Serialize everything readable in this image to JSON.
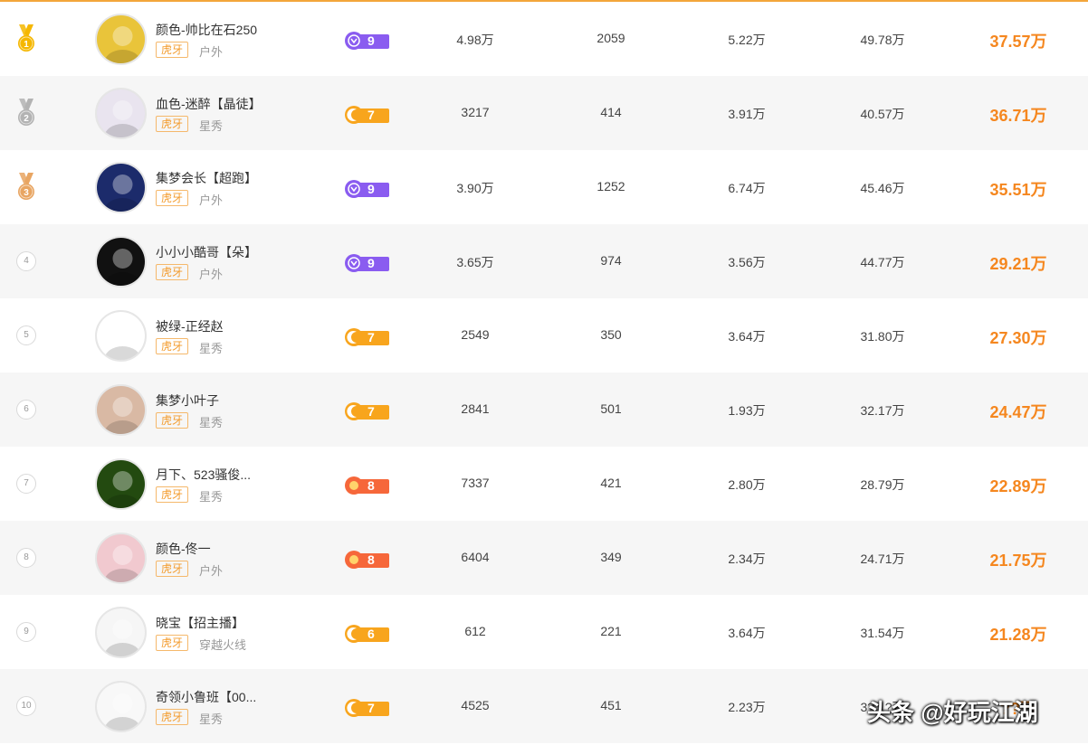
{
  "rows": [
    {
      "rank": "1",
      "name": "颜色-帅比在石250",
      "platform": "虎牙",
      "category": "户外",
      "level": "9",
      "levelColor": "#8a5cf0",
      "levelIcon": "purple",
      "v1": "4.98万",
      "v2": "2059",
      "v3": "5.22万",
      "v4": "49.78万",
      "total": "37.57万"
    },
    {
      "rank": "2",
      "name": "血色-迷醉【晶徒】",
      "platform": "虎牙",
      "category": "星秀",
      "level": "7",
      "levelColor": "#f8a51d",
      "levelIcon": "orange",
      "v1": "3217",
      "v2": "414",
      "v3": "3.91万",
      "v4": "40.57万",
      "total": "36.71万"
    },
    {
      "rank": "3",
      "name": "集梦会长【超跑】",
      "platform": "虎牙",
      "category": "户外",
      "level": "9",
      "levelColor": "#8a5cf0",
      "levelIcon": "purple",
      "v1": "3.90万",
      "v2": "1252",
      "v3": "6.74万",
      "v4": "45.46万",
      "total": "35.51万"
    },
    {
      "rank": "4",
      "name": "小小小酷哥【朵】",
      "platform": "虎牙",
      "category": "户外",
      "level": "9",
      "levelColor": "#8a5cf0",
      "levelIcon": "purple",
      "v1": "3.65万",
      "v2": "974",
      "v3": "3.56万",
      "v4": "44.77万",
      "total": "29.21万"
    },
    {
      "rank": "5",
      "name": "被绿-正经赵",
      "platform": "虎牙",
      "category": "星秀",
      "level": "7",
      "levelColor": "#f8a51d",
      "levelIcon": "orange",
      "v1": "2549",
      "v2": "350",
      "v3": "3.64万",
      "v4": "31.80万",
      "total": "27.30万"
    },
    {
      "rank": "6",
      "name": "集梦小叶子",
      "platform": "虎牙",
      "category": "星秀",
      "level": "7",
      "levelColor": "#f8a51d",
      "levelIcon": "orange",
      "v1": "2841",
      "v2": "501",
      "v3": "1.93万",
      "v4": "32.17万",
      "total": "24.47万"
    },
    {
      "rank": "7",
      "name": "月下、523骚俊...",
      "platform": "虎牙",
      "category": "星秀",
      "level": "8",
      "levelColor": "#f6673a",
      "levelIcon": "red",
      "v1": "7337",
      "v2": "421",
      "v3": "2.80万",
      "v4": "28.79万",
      "total": "22.89万"
    },
    {
      "rank": "8",
      "name": "颜色-佟一",
      "platform": "虎牙",
      "category": "户外",
      "level": "8",
      "levelColor": "#f6673a",
      "levelIcon": "red",
      "v1": "6404",
      "v2": "349",
      "v3": "2.34万",
      "v4": "24.71万",
      "total": "21.75万"
    },
    {
      "rank": "9",
      "name": "晓宝【招主播】",
      "platform": "虎牙",
      "category": "穿越火线",
      "level": "6",
      "levelColor": "#f8a51d",
      "levelIcon": "orange",
      "v1": "612",
      "v2": "221",
      "v3": "3.64万",
      "v4": "31.54万",
      "total": "21.28万"
    },
    {
      "rank": "10",
      "name": "奇领小鲁班【00...",
      "platform": "虎牙",
      "category": "星秀",
      "level": "7",
      "levelColor": "#f8a51d",
      "levelIcon": "orange",
      "v1": "4525",
      "v2": "451",
      "v3": "2.23万",
      "v4": "3?.1?万",
      "total": "??万"
    }
  ],
  "watermark": "头条 @好玩江湖",
  "colors": {
    "accent": "#f5871f",
    "border": "#f3a63b",
    "gold": "#f5b700",
    "silver": "#b3b3b3",
    "bronze": "#e8a562"
  }
}
